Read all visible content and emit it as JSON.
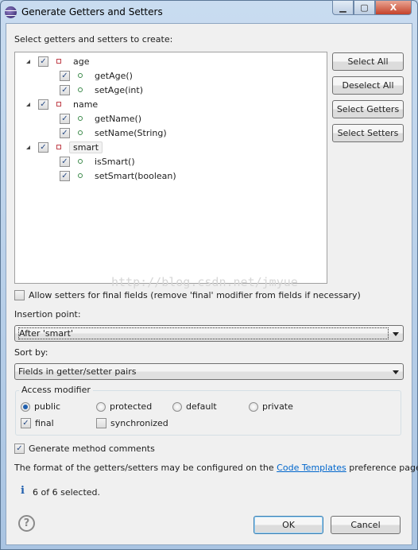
{
  "window": {
    "title": "Generate Getters and Setters",
    "minimize": "▁",
    "maximize": "▢",
    "close": "X"
  },
  "tree_label": "Select getters and setters to create:",
  "tree": [
    {
      "label": "age",
      "checked": true,
      "children": [
        {
          "label": "getAge()",
          "checked": true
        },
        {
          "label": "setAge(int)",
          "checked": true
        }
      ]
    },
    {
      "label": "name",
      "checked": true,
      "children": [
        {
          "label": "getName()",
          "checked": true
        },
        {
          "label": "setName(String)",
          "checked": true
        }
      ]
    },
    {
      "label": "smart",
      "checked": true,
      "selected": true,
      "children": [
        {
          "label": "isSmart()",
          "checked": true
        },
        {
          "label": "setSmart(boolean)",
          "checked": true
        }
      ]
    }
  ],
  "side_buttons": [
    "Select All",
    "Deselect All",
    "Select Getters",
    "Select Setters"
  ],
  "watermark": "http://blog.csdn.net/jmyue",
  "allow_setters": {
    "label": "Allow setters for final fields (remove 'final' modifier from fields if necessary)",
    "checked": false
  },
  "insertion": {
    "label": "Insertion point:",
    "value": "After 'smart'"
  },
  "sort": {
    "label": "Sort by:",
    "value": "Fields in getter/setter pairs"
  },
  "access": {
    "title": "Access modifier",
    "radios": [
      {
        "label": "public",
        "selected": true
      },
      {
        "label": "protected",
        "selected": false
      },
      {
        "label": "default",
        "selected": false
      },
      {
        "label": "private",
        "selected": false
      }
    ],
    "final": {
      "label": "final",
      "checked": true
    },
    "synchronized": {
      "label": "synchronized",
      "checked": false
    }
  },
  "comments": {
    "label": "Generate method comments",
    "checked": true
  },
  "format": {
    "before": "The format of the getters/setters may be configured on the ",
    "link": "Code Templates",
    "after": " preference page."
  },
  "status": "6 of 6 selected.",
  "ok": "OK",
  "cancel": "Cancel",
  "colors": {
    "link": "#0066cc",
    "info": "#1f5fae"
  }
}
